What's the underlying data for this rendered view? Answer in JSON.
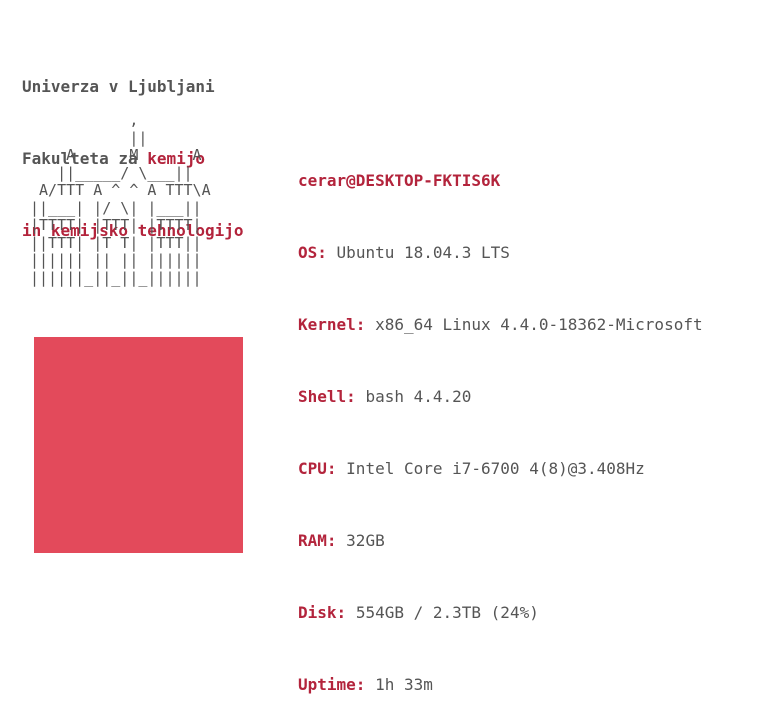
{
  "header": {
    "line1": "Univerza v Ljubljani",
    "line2_prefix": "Fakulteta za ",
    "line2_highlight": "kemijo",
    "line3": "in kemijsko tehnologijo"
  },
  "ascii_art": "           ,\n           ||\n    A      M      A\n   ||_____/ \\___||\n A/TTT A ^ ^ A TTT\\A\n||___| |/ \\| |___||\n|TTTT| |TTT| |TTTT|\n||TTT| |T T| |TTT||\n|||||| || || ||||||\n||||||_||_||_||||||",
  "info": {
    "user_host": "cerar@DESKTOP-FKTIS6K",
    "rows": [
      {
        "label": "OS:",
        "value": "Ubuntu 18.04.3 LTS"
      },
      {
        "label": "Kernel:",
        "value": "x86_64 Linux 4.4.0-18362-Microsoft"
      },
      {
        "label": "Shell:",
        "value": "bash 4.4.20"
      },
      {
        "label": "CPU:",
        "value": "Intel Core i7-6700 4(8)@3.408Hz"
      },
      {
        "label": "RAM:",
        "value": "32GB"
      },
      {
        "label": "Disk:",
        "value": "554GB / 2.3TB (24%)"
      },
      {
        "label": "Uptime:",
        "value": "1h 33m"
      }
    ]
  },
  "colors": {
    "accent": "#b3243c",
    "swatch": "#e34a5b",
    "text": "#555555"
  }
}
